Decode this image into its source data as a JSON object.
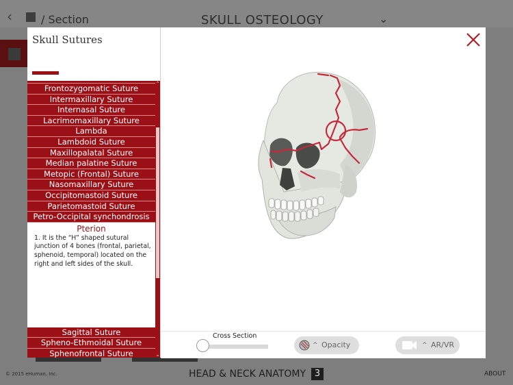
{
  "background": {
    "nav": {
      "section_label": "Section",
      "title": "SKULL OSTEOLOGY"
    },
    "footer": {
      "copyright": "© 2015 eHuman, Inc.",
      "book_title": "HEAD & NECK ANATOMY",
      "book_number": "3",
      "about": "ABOUT"
    }
  },
  "panel": {
    "title": "Skull Sutures",
    "items_above": [
      "Frontozygomatic Suture",
      "Intermaxillary Suture",
      "Internasal Suture",
      "Lacrimomaxillary Suture",
      "Lambda",
      "Lambdoid Suture",
      "Maxillopalatal Suture",
      "Median palatine Suture",
      "Metopic (Frontal) Suture",
      "Nasomaxillary Suture",
      "Occipitomastoid Suture",
      "Parietomastoid Suture",
      "Petro-Occipital synchondrosis"
    ],
    "expanded": {
      "name": "Pterion",
      "description": "1. It is the “H” shaped sutural junction of 4 bones (frontal, parietal, sphenoid, temporal) located on the right and left sides of the skull."
    },
    "items_below": [
      "Sagittal Suture",
      "Spheno-Ethmoidal Suture",
      "Sphenofrontal Suture"
    ]
  },
  "controls": {
    "cross_section_label": "Cross Section",
    "cross_section_value": 0,
    "opacity_label": "Opacity",
    "arvr_label": "AR/VR"
  },
  "colors": {
    "accent": "#9b1016",
    "suture": "#c42a3a"
  },
  "icons": [
    "close-icon",
    "opacity-icon",
    "chevron-up-icon",
    "camera-icon"
  ]
}
